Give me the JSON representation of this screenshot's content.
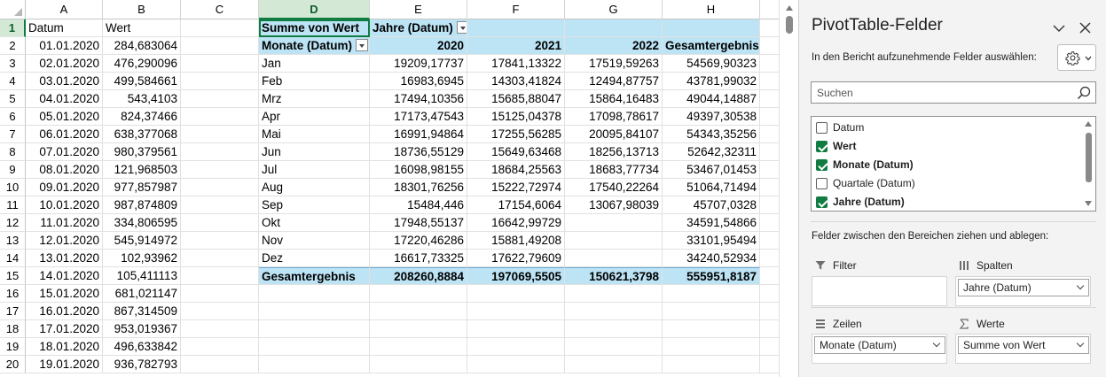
{
  "sheet": {
    "columns": [
      {
        "key": "A",
        "label": "A",
        "width": 87
      },
      {
        "key": "B",
        "label": "B",
        "width": 88
      },
      {
        "key": "C",
        "label": "C",
        "width": 88
      },
      {
        "key": "D",
        "label": "D",
        "width": 125
      },
      {
        "key": "E",
        "label": "E",
        "width": 110
      },
      {
        "key": "F",
        "label": "F",
        "width": 110
      },
      {
        "key": "G",
        "label": "G",
        "width": 110
      },
      {
        "key": "H",
        "label": "H",
        "width": 110
      }
    ],
    "selected_col": "D",
    "selected_row": "1",
    "rows": [
      {
        "n": "1",
        "A": "Datum",
        "B": "Wert",
        "D": "Summe von Wert",
        "E": "Jahre (Datum)",
        "F": "",
        "G": "",
        "H": ""
      },
      {
        "n": "2",
        "A": "01.01.2020",
        "B": "284,683064",
        "D": "Monate (Datum)",
        "E": "2020",
        "F": "2021",
        "G": "2022",
        "H": "Gesamtergebnis"
      },
      {
        "n": "3",
        "A": "02.01.2020",
        "B": "476,290096",
        "D": "Jan",
        "E": "19209,17737",
        "F": "17841,13322",
        "G": "17519,59263",
        "H": "54569,90323"
      },
      {
        "n": "4",
        "A": "03.01.2020",
        "B": "499,584661",
        "D": "Feb",
        "E": "16983,6945",
        "F": "14303,41824",
        "G": "12494,87757",
        "H": "43781,99032"
      },
      {
        "n": "5",
        "A": "04.01.2020",
        "B": "543,4103",
        "D": "Mrz",
        "E": "17494,10356",
        "F": "15685,88047",
        "G": "15864,16483",
        "H": "49044,14887"
      },
      {
        "n": "6",
        "A": "05.01.2020",
        "B": "824,37466",
        "D": "Apr",
        "E": "17173,47543",
        "F": "15125,04378",
        "G": "17098,78617",
        "H": "49397,30538"
      },
      {
        "n": "7",
        "A": "06.01.2020",
        "B": "638,377068",
        "D": "Mai",
        "E": "16991,94864",
        "F": "17255,56285",
        "G": "20095,84107",
        "H": "54343,35256"
      },
      {
        "n": "8",
        "A": "07.01.2020",
        "B": "980,379561",
        "D": "Jun",
        "E": "18736,55129",
        "F": "15649,63468",
        "G": "18256,13713",
        "H": "52642,32311"
      },
      {
        "n": "9",
        "A": "08.01.2020",
        "B": "121,968503",
        "D": "Jul",
        "E": "16098,98155",
        "F": "18684,25563",
        "G": "18683,77734",
        "H": "53467,01453"
      },
      {
        "n": "10",
        "A": "09.01.2020",
        "B": "977,857987",
        "D": "Aug",
        "E": "18301,76256",
        "F": "15222,72974",
        "G": "17540,22264",
        "H": "51064,71494"
      },
      {
        "n": "11",
        "A": "10.01.2020",
        "B": "987,874809",
        "D": "Sep",
        "E": "15484,446",
        "F": "17154,6064",
        "G": "13067,98039",
        "H": "45707,0328"
      },
      {
        "n": "12",
        "A": "11.01.2020",
        "B": "334,806595",
        "D": "Okt",
        "E": "17948,55137",
        "F": "16642,99729",
        "G": "",
        "H": "34591,54866"
      },
      {
        "n": "13",
        "A": "12.01.2020",
        "B": "545,914972",
        "D": "Nov",
        "E": "17220,46286",
        "F": "15881,49208",
        "G": "",
        "H": "33101,95494"
      },
      {
        "n": "14",
        "A": "13.01.2020",
        "B": "102,93962",
        "D": "Dez",
        "E": "16617,73325",
        "F": "17622,79609",
        "G": "",
        "H": "34240,52934"
      },
      {
        "n": "15",
        "A": "14.01.2020",
        "B": "105,411113",
        "D": "Gesamtergebnis",
        "E": "208260,8884",
        "F": "197069,5505",
        "G": "150621,3798",
        "H": "555951,8187"
      },
      {
        "n": "16",
        "A": "15.01.2020",
        "B": "681,021147",
        "D": "",
        "E": "",
        "F": "",
        "G": "",
        "H": ""
      },
      {
        "n": "17",
        "A": "16.01.2020",
        "B": "867,314509",
        "D": "",
        "E": "",
        "F": "",
        "G": "",
        "H": ""
      },
      {
        "n": "18",
        "A": "17.01.2020",
        "B": "953,019367",
        "D": "",
        "E": "",
        "F": "",
        "G": "",
        "H": ""
      },
      {
        "n": "19",
        "A": "18.01.2020",
        "B": "496,633842",
        "D": "",
        "E": "",
        "F": "",
        "G": "",
        "H": ""
      },
      {
        "n": "20",
        "A": "19.01.2020",
        "B": "936,782793",
        "D": "",
        "E": "",
        "F": "",
        "G": "",
        "H": ""
      }
    ]
  },
  "pane": {
    "title": "PivotTable-Felder",
    "include_label": "In den Bericht aufzunehmende Felder auswählen:",
    "search_placeholder": "Suchen",
    "fields": [
      {
        "label": "Datum",
        "checked": false
      },
      {
        "label": "Wert",
        "checked": true
      },
      {
        "label": "Monate (Datum)",
        "checked": true
      },
      {
        "label": "Quartale (Datum)",
        "checked": false
      },
      {
        "label": "Jahre (Datum)",
        "checked": true
      }
    ],
    "drag_label": "Felder zwischen den Bereichen ziehen und ablegen:",
    "areas": {
      "filter": {
        "title": "Filter",
        "items": []
      },
      "columns": {
        "title": "Spalten",
        "items": [
          "Jahre (Datum)"
        ]
      },
      "rows": {
        "title": "Zeilen",
        "items": [
          "Monate (Datum)"
        ]
      },
      "values": {
        "title": "Werte",
        "items": [
          "Summe von Wert"
        ]
      }
    }
  },
  "colors": {
    "accent": "#107c41",
    "pivot_band": "#bde4f5"
  }
}
